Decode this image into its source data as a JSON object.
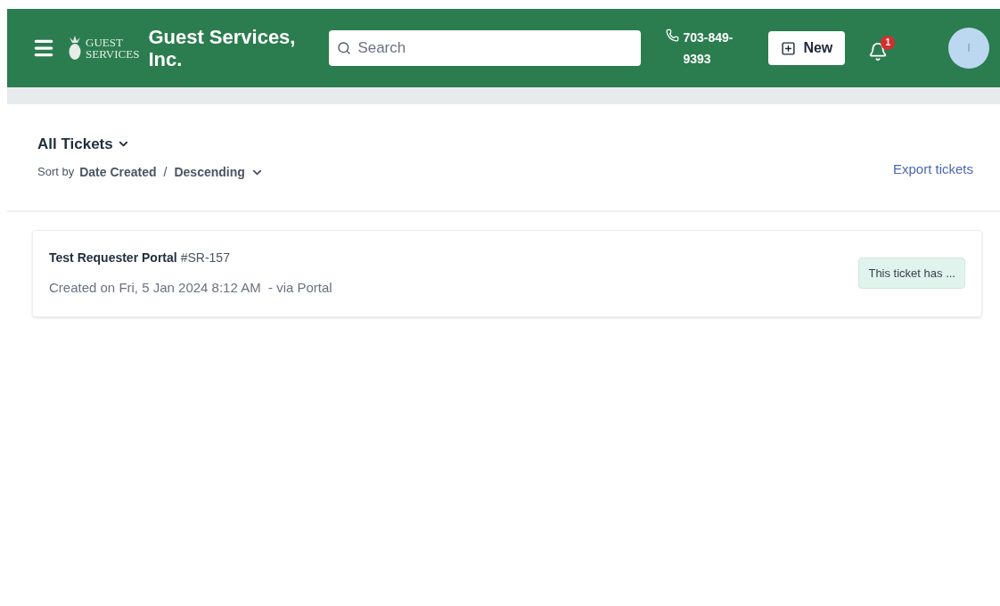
{
  "header": {
    "logo_lines": [
      "GUEST",
      "SERVICES"
    ],
    "title": "Guest Services, Inc.",
    "search": {
      "placeholder": "Search"
    },
    "phone": "703-849-9393",
    "new_button": "New",
    "notifications": {
      "count": "1"
    },
    "avatar": "I"
  },
  "toolbar": {
    "view": "All Tickets",
    "sort_label": "Sort by",
    "sort_field": "Date Created",
    "separator": "/",
    "sort_order": "Descending",
    "export": "Export tickets"
  },
  "tickets": [
    {
      "title": "Test Requester Portal",
      "id": "#SR-157",
      "meta": "Created on Fri, 5 Jan 2024 8:12 AM  - via Portal",
      "status": "This ticket has ..."
    }
  ]
}
